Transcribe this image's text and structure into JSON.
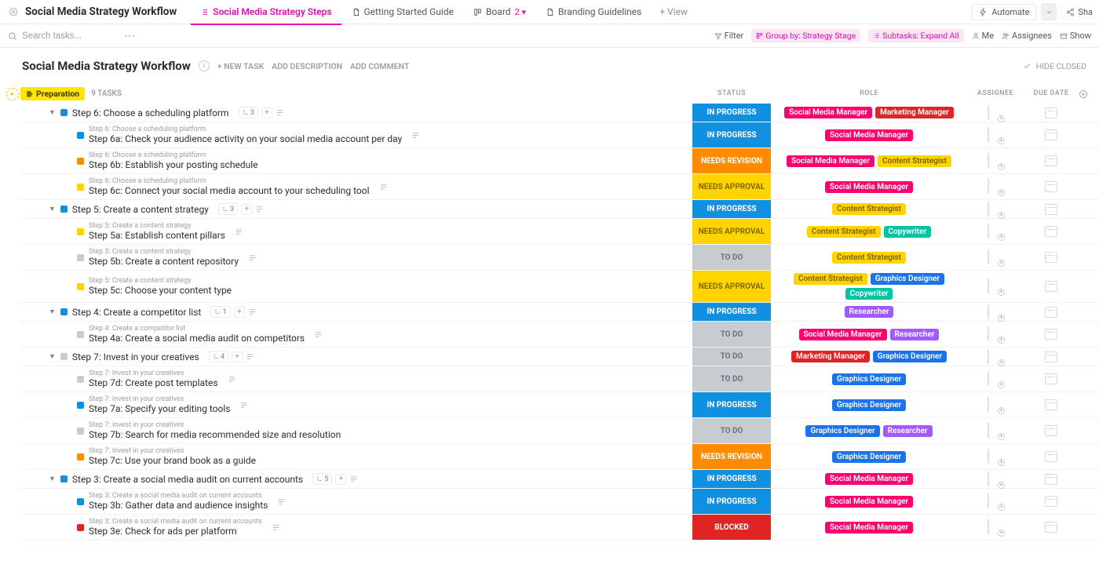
{
  "top": {
    "title": "Social Media Strategy Workflow",
    "tabs": [
      {
        "icon": "list",
        "label": "Social Media Strategy Steps",
        "active": true
      },
      {
        "icon": "doc",
        "label": "Getting Started Guide"
      },
      {
        "icon": "board",
        "label": "Board",
        "count": "2"
      },
      {
        "icon": "doc",
        "label": "Branding Guidelines"
      }
    ],
    "addView": "+ View",
    "automate": "Automate",
    "share": "Sha"
  },
  "toolbar": {
    "searchPlaceholder": "Search tasks...",
    "filter": "Filter",
    "group": "Group by: Strategy Stage",
    "subtasks": "Subtasks: Expand All",
    "me": "Me",
    "assignees": "Assignees",
    "show": "Show"
  },
  "header": {
    "title": "Social Media Strategy Workflow",
    "newTask": "+ NEW TASK",
    "addDesc": "ADD DESCRIPTION",
    "addComment": "ADD COMMENT",
    "hideClosed": "HIDE CLOSED"
  },
  "group": {
    "badge": "Preparation",
    "count": "9 TASKS",
    "columns": {
      "status": "STATUS",
      "role": "ROLE",
      "assignee": "ASSIGNEE",
      "due": "DUE DATE"
    }
  },
  "roleColors": {
    "Social Media Manager": "t-smm",
    "Marketing Manager": "t-mm",
    "Content Strategist": "t-cs",
    "Copywriter": "t-cw",
    "Graphics Designer": "t-gd",
    "Researcher": "t-res"
  },
  "squareColors": {
    "IN PROGRESS": "#1090e0",
    "NEEDS REVISION": "#ff8b00",
    "NEEDS APPROVAL": "#ffd400",
    "TO DO": "#c7ccd1",
    "BLOCKED": "#e02424"
  },
  "rows": [
    {
      "type": "parent",
      "title": "Step 6: Choose a scheduling platform",
      "sub": "3",
      "status": "IN PROGRESS",
      "roles": [
        "Social Media Manager",
        "Marketing Manager"
      ]
    },
    {
      "type": "child",
      "crumb": "Step 6: Choose a scheduling platform",
      "title": "Step 6a: Check your audience activity on your social media account per day",
      "status": "IN PROGRESS",
      "roles": [
        "Social Media Manager"
      ],
      "hasDesc": true
    },
    {
      "type": "child",
      "crumb": "Step 6: Choose a scheduling platform",
      "title": "Step 6b: Establish your posting schedule",
      "status": "NEEDS REVISION",
      "roles": [
        "Social Media Manager",
        "Content Strategist"
      ]
    },
    {
      "type": "child",
      "crumb": "Step 6: Choose a scheduling platform",
      "title": "Step 6c: Connect your social media account to your scheduling tool",
      "status": "NEEDS APPROVAL",
      "roles": [
        "Social Media Manager"
      ],
      "hasDesc": true
    },
    {
      "type": "parent",
      "title": "Step 5: Create a content strategy",
      "sub": "3",
      "status": "IN PROGRESS",
      "roles": [
        "Content Strategist"
      ]
    },
    {
      "type": "child",
      "crumb": "Step 5: Create a content strategy",
      "title": "Step 5a: Establish content pillars",
      "status": "NEEDS APPROVAL",
      "roles": [
        "Content Strategist",
        "Copywriter"
      ],
      "hasDesc": true
    },
    {
      "type": "child",
      "crumb": "Step 5: Create a content strategy",
      "title": "Step 5b: Create a content repository",
      "status": "TO DO",
      "roles": [
        "Content Strategist"
      ],
      "hasDesc": true
    },
    {
      "type": "child",
      "crumb": "Step 5: Create a content strategy",
      "title": "Step 5c: Choose your content type",
      "status": "NEEDS APPROVAL",
      "roles": [
        "Content Strategist",
        "Graphics Designer",
        "Copywriter"
      ]
    },
    {
      "type": "parent",
      "title": "Step 4: Create a competitor list",
      "sub": "1",
      "status": "IN PROGRESS",
      "roles": [
        "Researcher"
      ]
    },
    {
      "type": "child",
      "crumb": "Step 4: Create a competitor list",
      "title": "Step 4a: Create a social media audit on competitors",
      "status": "TO DO",
      "roles": [
        "Social Media Manager",
        "Researcher"
      ],
      "hasDesc": true
    },
    {
      "type": "parent",
      "title": "Step 7: Invest in your creatives",
      "sub": "4",
      "status": "TO DO",
      "roles": [
        "Marketing Manager",
        "Graphics Designer"
      ]
    },
    {
      "type": "child",
      "crumb": "Step 7: Invest in your creatives",
      "title": "Step 7d: Create post templates",
      "status": "TO DO",
      "roles": [
        "Graphics Designer"
      ],
      "hasDesc": true
    },
    {
      "type": "child",
      "crumb": "Step 7: Invest in your creatives",
      "title": "Step 7a: Specify your editing tools",
      "status": "IN PROGRESS",
      "roles": [
        "Graphics Designer"
      ],
      "hasDesc": true
    },
    {
      "type": "child",
      "crumb": "Step 7: Invest in your creatives",
      "title": "Step 7b: Search for media recommended size and resolution",
      "status": "TO DO",
      "roles": [
        "Graphics Designer",
        "Researcher"
      ]
    },
    {
      "type": "child",
      "crumb": "Step 7: Invest in your creatives",
      "title": "Step 7c: Use your brand book as a guide",
      "status": "NEEDS REVISION",
      "roles": [
        "Graphics Designer"
      ]
    },
    {
      "type": "parent",
      "title": "Step 3: Create a social media audit on current accounts",
      "sub": "5",
      "status": "IN PROGRESS",
      "roles": [
        "Social Media Manager"
      ]
    },
    {
      "type": "child",
      "crumb": "Step 3: Create a social media audit on current accounts",
      "title": "Step 3b: Gather data and audience insights",
      "status": "IN PROGRESS",
      "roles": [
        "Social Media Manager"
      ],
      "hasDesc": true
    },
    {
      "type": "child",
      "crumb": "Step 3: Create a social media audit on current accounts",
      "title": "Step 3e: Check for ads per platform",
      "status": "BLOCKED",
      "roles": [
        "Social Media Manager"
      ],
      "hasDesc": true
    }
  ]
}
